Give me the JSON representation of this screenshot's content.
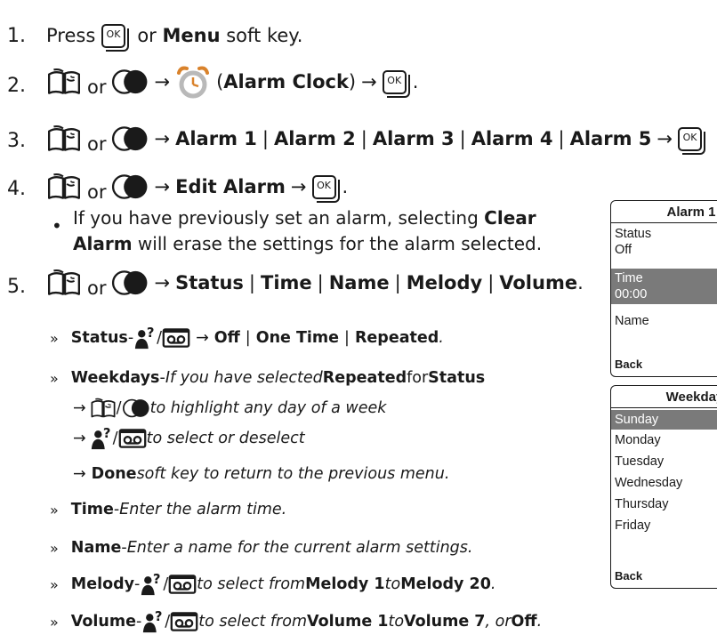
{
  "steps": [
    {
      "num": "1.",
      "press": "Press",
      "or": "or",
      "menu": "Menu",
      "softkey": "soft key."
    },
    {
      "num": "2.",
      "or": "or",
      "arrow": "→",
      "open_paren": "(",
      "alarm_clock": "Alarm Clock",
      "close_paren": ")",
      "arrow2": "→",
      "period": "."
    },
    {
      "num": "3.",
      "or": "or",
      "arrow": "→",
      "alarms": [
        "Alarm 1",
        "Alarm 2",
        "Alarm 3",
        "Alarm 4",
        "Alarm 5"
      ],
      "sep": "|",
      "arrow2": "→"
    },
    {
      "num": "4.",
      "or": "or",
      "arrow": "→",
      "edit_alarm": "Edit Alarm",
      "arrow2": "→",
      "period": ".",
      "bullet_pre": "If you have previously set an alarm, selecting ",
      "clear_alarm": "Clear Alarm",
      "bullet_post": " will erase the settings for the alarm selected."
    },
    {
      "num": "5.",
      "or": "or",
      "arrow": "→",
      "options": [
        "Status",
        "Time",
        "Name",
        "Melody",
        "Volume"
      ],
      "sep": "|",
      "period": "."
    }
  ],
  "ok_label": "OK",
  "subs": {
    "chevron": "»",
    "status": {
      "label": "Status",
      "dash": " - ",
      "slash": " / ",
      "arrow": "→",
      "off": "Off",
      "sep": "|",
      "one_time": "One Time",
      "repeated": "Repeated",
      "period": "."
    },
    "weekdays": {
      "label": "Weekdays",
      "dash": " - ",
      "pre": "If you have selected ",
      "repeated": "Repeated",
      "for": " for ",
      "status": "Status",
      "line2_arrow": "→",
      "line2_slash": " / ",
      "line2_text": " to highlight any day of a week",
      "line3_arrow": "→",
      "line3_slash": " / ",
      "line3_text": " to select or deselect",
      "line4_arrow": "→",
      "done": "Done",
      "line4_text": " soft key to return to the previous menu."
    },
    "time": {
      "label": "Time",
      "dash": " - ",
      "text": "Enter the alarm time."
    },
    "name": {
      "label": "Name",
      "dash": " - ",
      "text": "Enter a name for the current alarm settings."
    },
    "melody": {
      "label": "Melody",
      "dash": " - ",
      "slash": " / ",
      "text": " to select from ",
      "from": "Melody 1",
      "to": " to ",
      "to_val": "Melody 20",
      "period": "."
    },
    "volume": {
      "label": "Volume",
      "dash": " - ",
      "slash": " / ",
      "text": " to select from ",
      "from": "Volume 1",
      "to": " to ",
      "to_val": "Volume 7",
      "or": ", or ",
      "off": "Off",
      "period": "."
    }
  },
  "screen1": {
    "title": "Alarm 1",
    "status_label": "Status",
    "status_value": "Off",
    "time_label": "Time",
    "time_value": "00:00",
    "name_label": "Name",
    "back": "Back"
  },
  "screen2": {
    "title": "Weekday",
    "days": [
      "Sunday",
      "Monday",
      "Tuesday",
      "Wednesday",
      "Thursday",
      "Friday"
    ],
    "back": "Back"
  }
}
